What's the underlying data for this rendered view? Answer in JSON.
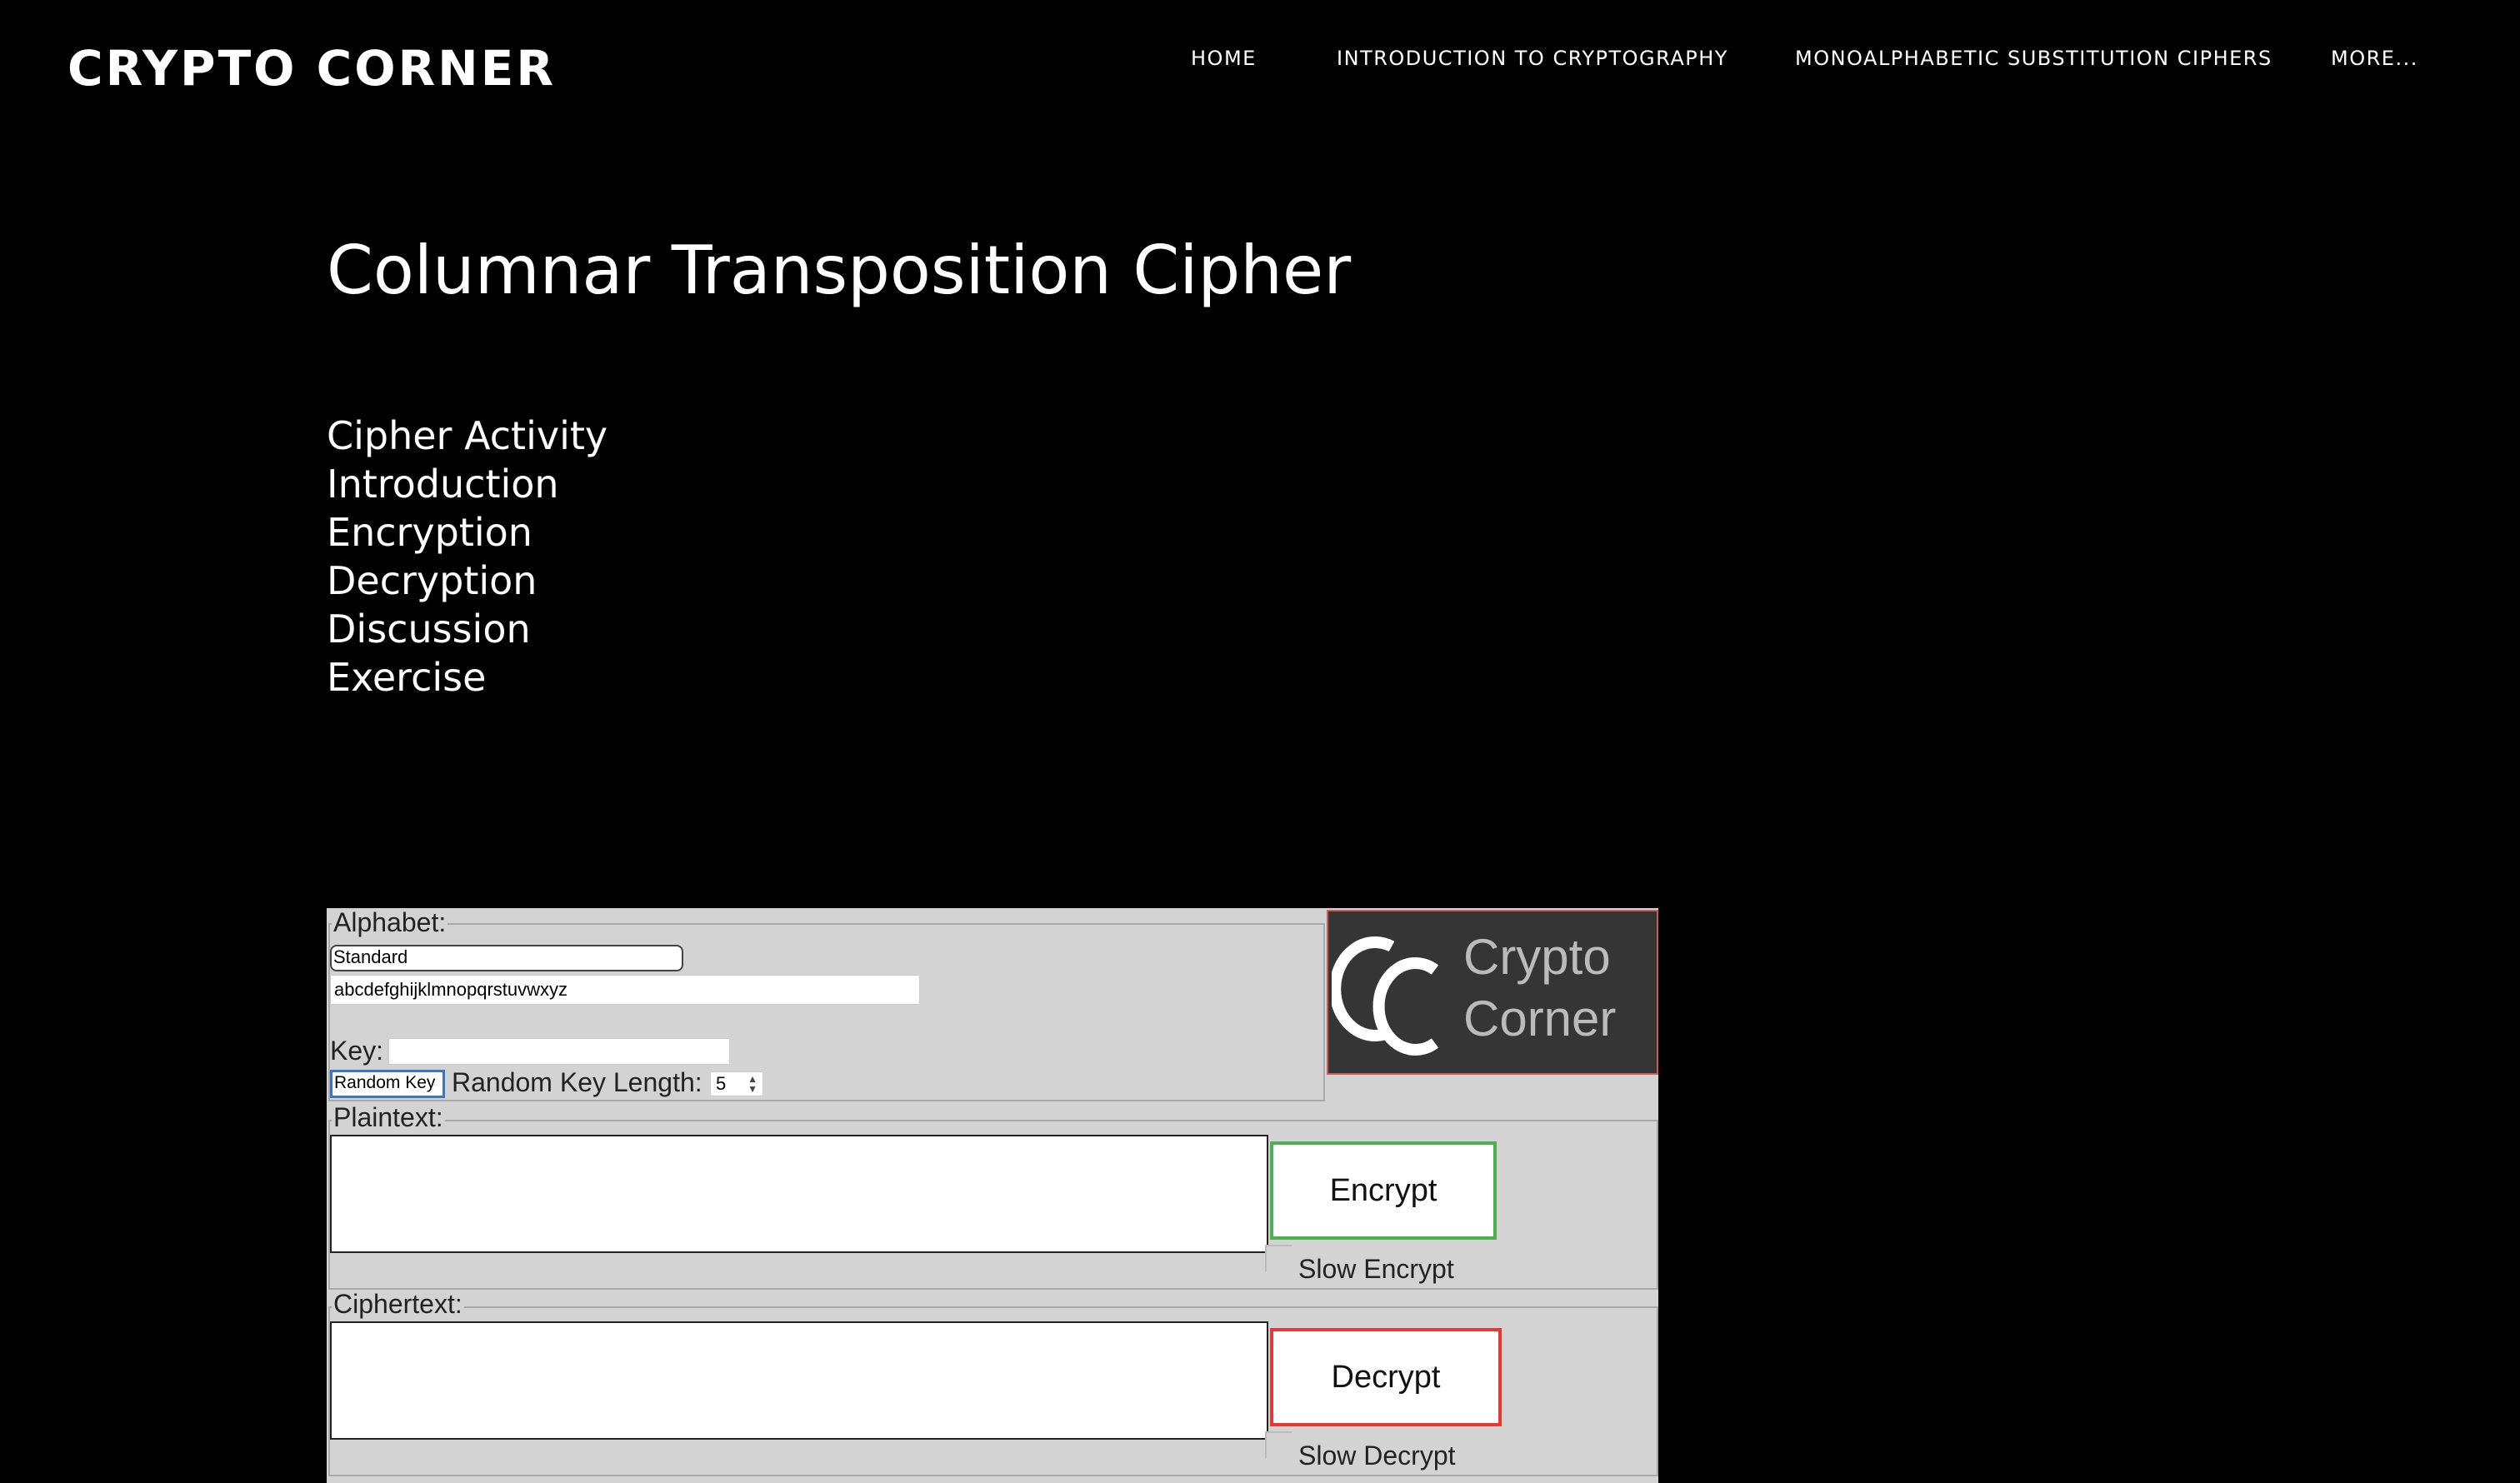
{
  "site": {
    "title": "CRYPTO CORNER"
  },
  "nav": {
    "home": "HOME",
    "intro": "INTRODUCTION TO CRYPTOGRAPHY",
    "mono": "MONOALPHABETIC SUBSTITUTION CIPHERS",
    "more": "MORE..."
  },
  "page": {
    "title": "Columnar Transposition Cipher",
    "toc": [
      "Cipher Activity",
      "Introduction",
      "Encryption",
      "Decryption",
      "Discussion",
      "Exercise"
    ]
  },
  "widget": {
    "alphabet_legend": "Alphabet:",
    "alphabet_select": "Standard",
    "alphabet_value": "abcdefghijklmnopqrstuvwxyz",
    "key_label": "Key:",
    "key_value": "",
    "random_key_button": "Random Key",
    "random_key_length_label": "Random Key Length:",
    "random_key_length_value": "5",
    "plaintext_legend": "Plaintext:",
    "plaintext_value": "",
    "encrypt_button": "Encrypt",
    "slow_encrypt_label": "Slow Encrypt",
    "ciphertext_legend": "Ciphertext:",
    "ciphertext_value": "",
    "decrypt_button": "Decrypt",
    "slow_decrypt_label": "Slow Decrypt",
    "logo_line1": "Crypto",
    "logo_line2": "Corner"
  },
  "colors": {
    "background": "#000000",
    "widget_bg": "#d3d3d3",
    "encrypt_border": "#4caf50",
    "decrypt_border": "#e53935",
    "logo_bg": "#353535"
  }
}
